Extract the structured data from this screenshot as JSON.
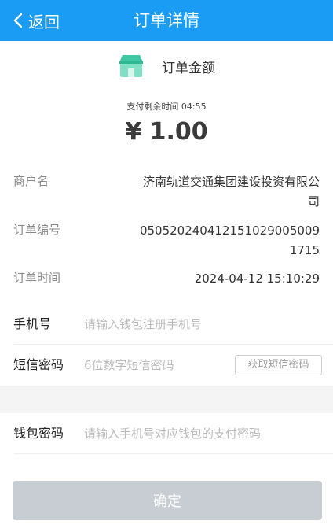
{
  "header": {
    "back_label": "返回",
    "title": "订单详情"
  },
  "order": {
    "amount_label": "订单金额",
    "remaining_time_label": "支付剩余时间 04:55",
    "amount": "¥ 1.00"
  },
  "details": [
    {
      "label": "商户名",
      "value": "济南轨道交通集团建设投资有限公司"
    },
    {
      "label": "订单编号",
      "value": "0505202404121510290050091715"
    },
    {
      "label": "订单时间",
      "value": "2024-04-12 15:10:29"
    }
  ],
  "form": {
    "phone": {
      "label": "手机号",
      "placeholder": "请输入钱包注册手机号"
    },
    "sms": {
      "label": "短信密码",
      "placeholder": "6位数字短信密码",
      "button": "获取短信密码"
    },
    "wallet": {
      "label": "钱包密码",
      "placeholder": "请输入手机号对应钱包的支付密码"
    }
  },
  "confirm_label": "确定",
  "colors": {
    "primary": "#1a9cf5",
    "disabled_button": "#c8cdd4",
    "section_gap": "#f4f4f4"
  }
}
